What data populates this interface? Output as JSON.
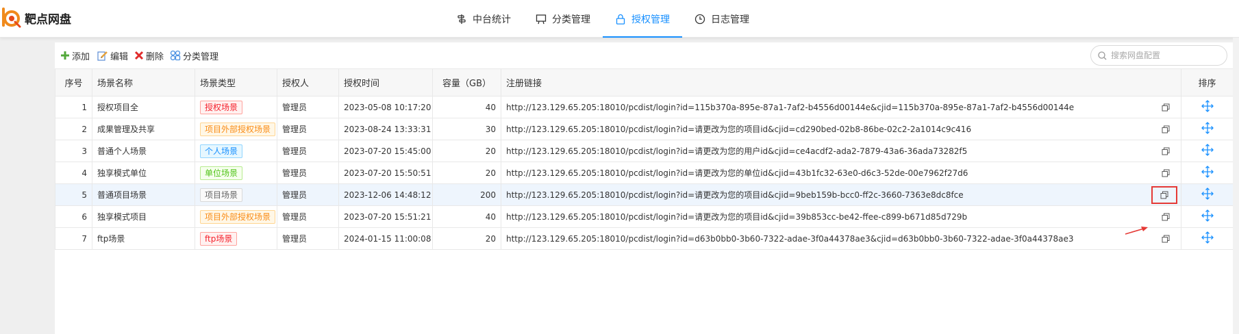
{
  "app": {
    "logo_text": "靶点网盘",
    "accent": "#1890ff"
  },
  "nav": [
    {
      "label": "中台统计",
      "icon": "stats-icon"
    },
    {
      "label": "分类管理",
      "icon": "category-icon"
    },
    {
      "label": "授权管理",
      "icon": "lock-icon",
      "active": true
    },
    {
      "label": "日志管理",
      "icon": "clock-icon"
    }
  ],
  "toolbar": {
    "add_label": "添加",
    "edit_label": "编辑",
    "delete_label": "删除",
    "category_label": "分类管理",
    "search_placeholder": "搜索网盘配置"
  },
  "table": {
    "columns": [
      "序号",
      "场景名称",
      "场景类型",
      "授权人",
      "授权时间",
      "容量（GB）",
      "注册链接",
      "排序"
    ],
    "rows": [
      {
        "no": "1",
        "name": "授权项目全",
        "type": "授权场景",
        "type_style": "red",
        "owner": "管理员",
        "time": "2023-05-08 10:17:20",
        "capacity": "40",
        "link": "http://123.129.65.205:18010/pcdist/login?id=115b370a-895e-87a1-7af2-b4556d00144e&cjid=115b370a-895e-87a1-7af2-b4556d00144e"
      },
      {
        "no": "2",
        "name": "成果管理及共享",
        "type": "项目外部授权场景",
        "type_style": "orange",
        "owner": "管理员",
        "time": "2023-08-24 13:33:31",
        "capacity": "30",
        "link": "http://123.129.65.205:18010/pcdist/login?id=请更改为您的项目id&cjid=cd290bed-02b8-86be-02c2-2a1014c9c416"
      },
      {
        "no": "3",
        "name": "普通个人场景",
        "type": "个人场景",
        "type_style": "blue",
        "owner": "管理员",
        "time": "2023-07-20 15:45:00",
        "capacity": "20",
        "link": "http://123.129.65.205:18010/pcdist/login?id=请更改为您的用户id&cjid=ce4acdf2-ada2-7879-43a6-36ada73282f5"
      },
      {
        "no": "4",
        "name": "独享模式单位",
        "type": "单位场景",
        "type_style": "green",
        "owner": "管理员",
        "time": "2023-07-20 15:50:51",
        "capacity": "20",
        "link": "http://123.129.65.205:18010/pcdist/login?id=请更改为您的单位id&cjid=43b1fc32-63e0-d6c3-52de-00e7962f27d6"
      },
      {
        "no": "5",
        "name": "普通项目场景",
        "type": "项目场景",
        "type_style": "gray",
        "owner": "管理员",
        "time": "2023-12-06 14:48:12",
        "capacity": "200",
        "link": "http://123.129.65.205:18010/pcdist/login?id=请更改为您的项目id&cjid=9beb159b-bcc0-ff2c-3660-7363e8dc8fce",
        "highlight": true
      },
      {
        "no": "6",
        "name": "独享模式项目",
        "type": "项目外部授权场景",
        "type_style": "orange",
        "owner": "管理员",
        "time": "2023-07-20 15:51:21",
        "capacity": "40",
        "link": "http://123.129.65.205:18010/pcdist/login?id=请更改为您的项目id&cjid=39b853cc-be42-ffee-c899-b671d85d729b"
      },
      {
        "no": "7",
        "name": "ftp场景",
        "type": "ftp场景",
        "type_style": "red",
        "owner": "管理员",
        "time": "2024-01-15 11:00:08",
        "capacity": "20",
        "link": "http://123.129.65.205:18010/pcdist/login?id=d63b0bb0-3b60-7322-adae-3f0a44378ae3&cjid=d63b0bb0-3b60-7322-adae-3f0a44378ae3"
      }
    ]
  },
  "tag_colors": {
    "red": {
      "fg": "#f5222d",
      "bg": "#fff1f0",
      "border": "#ffa39e"
    },
    "orange": {
      "fg": "#fa8c16",
      "bg": "#fff7e6",
      "border": "#ffd591"
    },
    "blue": {
      "fg": "#1890ff",
      "bg": "#e6f7ff",
      "border": "#91d5ff"
    },
    "green": {
      "fg": "#52c41a",
      "bg": "#f6ffed",
      "border": "#b7eb8f"
    },
    "gray": {
      "fg": "#666666",
      "bg": "#fafafa",
      "border": "#d9d9d9"
    }
  },
  "annotation_color": "#e53935"
}
